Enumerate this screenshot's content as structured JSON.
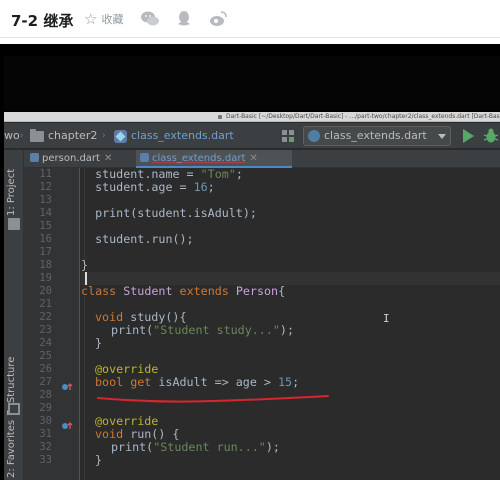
{
  "article": {
    "title": "7-2 继承",
    "favorite_label": "收藏",
    "share_icons": [
      "wechat-icon",
      "qq-icon",
      "weibo-icon"
    ]
  },
  "ide": {
    "window_title": "Dart-Basic [~/Desktop/Dart/Dart-Basic] - .../part-two/chapter2/class_extends.dart [Dart-Basic",
    "nav": {
      "partial_left": "wo",
      "folder": "chapter2",
      "file": "class_extends.dart"
    },
    "run_config": "class_extends.dart",
    "tabs": [
      {
        "label": "person.dart",
        "active": false
      },
      {
        "label": "class_extends.dart",
        "active": true
      }
    ],
    "side_tools": [
      "1: Project",
      "7: Structure",
      "2: Favorites"
    ],
    "line_numbers": [
      "11",
      "12",
      "13",
      "14",
      "15",
      "16",
      "17",
      "18",
      "19",
      "20",
      "21",
      "22",
      "23",
      "24",
      "25",
      "26",
      "27",
      "28",
      "29",
      "30",
      "31",
      "32",
      "33"
    ],
    "gutter_markers": [
      "27",
      "31"
    ],
    "colors": {
      "background": "#2b2b2b",
      "keyword": "#cc7832",
      "class_name": "#c7a2dc",
      "string": "#6a8759",
      "number": "#6897bb",
      "annotation": "#bbb529",
      "plain": "#a9b7c6",
      "underline": "#d6272e"
    },
    "code": {
      "l11": {
        "a": "  student.name = ",
        "s": "\"Tom\"",
        "b": ";"
      },
      "l12": {
        "a": "  student.age = ",
        "n": "16",
        "b": ";"
      },
      "l14": "  print(student.isAdult);",
      "l16": "  student.run();",
      "l18": "}",
      "l20": {
        "k1": "class",
        "c1": "Student",
        "k2": "extends",
        "c2": "Person",
        "b": "{"
      },
      "l22": {
        "k": "void",
        "b": " study(){"
      },
      "l23": {
        "a": "print(",
        "s": "\"Student study...\"",
        "b": ");"
      },
      "l24": "}",
      "l26": "@override",
      "l27": {
        "k1": "bool",
        "k2": "get",
        "a": " isAdult => age > ",
        "n": "15",
        "b": ";"
      },
      "l30": "@override",
      "l31": {
        "k": "void",
        "b": " run() {"
      },
      "l32": {
        "a": "print(",
        "s": "\"Student run...\"",
        "b": ");"
      },
      "l33": "}"
    }
  }
}
